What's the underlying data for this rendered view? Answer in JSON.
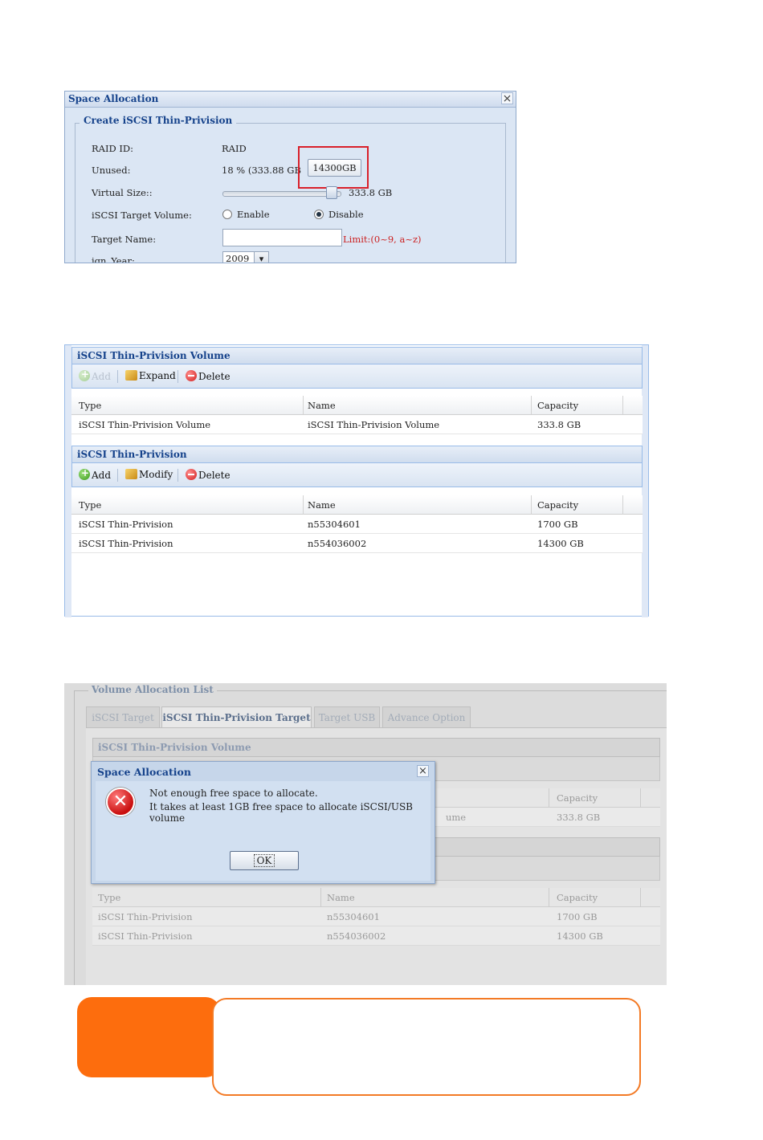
{
  "panel1": {
    "title": "Space Allocation",
    "close": "×",
    "legend": "Create iSCSI Thin-Privision",
    "labels": {
      "raid_id": "RAID ID:",
      "unused": "Unused:",
      "virtual_size": "Virtual Size::",
      "target_volume": "iSCSI Target Volume:",
      "target_name": "Target Name:",
      "iqn_year": "iqn_Year:"
    },
    "values": {
      "raid_id": "RAID",
      "unused": "18 % (333.88 GB",
      "size_button": "14300GB",
      "virtual_size": "333.8 GB",
      "slider_level": 0.96,
      "enable": "Enable",
      "disable": "Disable",
      "selected": "Disable",
      "target_name_value": "",
      "limit_hint": "Limit:(0~9, a~z)",
      "year": "2009",
      "year_arrow": "▾"
    },
    "highlight_color": "#d9202a"
  },
  "panel2": {
    "volume_section": {
      "title": "iSCSI Thin-Privision Volume",
      "toolbar": {
        "add": "Add",
        "expand": "Expand",
        "delete": "Delete"
      },
      "columns": [
        "Type",
        "Name",
        "Capacity"
      ],
      "rows": [
        {
          "type": "iSCSI Thin-Privision Volume",
          "name": "iSCSI Thin-Privision Volume",
          "capacity": "333.8 GB"
        }
      ]
    },
    "target_section": {
      "title": "iSCSI Thin-Privision",
      "toolbar": {
        "add": "Add",
        "modify": "Modify",
        "delete": "Delete"
      },
      "columns": [
        "Type",
        "Name",
        "Capacity"
      ],
      "rows": [
        {
          "type": "iSCSI Thin-Privision",
          "name": "n55304601",
          "capacity": "1700 GB"
        },
        {
          "type": "iSCSI Thin-Privision",
          "name": "n554036002",
          "capacity": "14300 GB"
        }
      ]
    }
  },
  "panel3": {
    "legend": "Volume Allocation List",
    "tabs": [
      "iSCSI Target",
      "iSCSI Thin-Privision Target",
      "Target USB",
      "Advance Option"
    ],
    "active_tab": "iSCSI Thin-Privision Target",
    "volume_section_title": "iSCSI Thin-Privision Volume",
    "columns": [
      "Type",
      "Name",
      "Capacity"
    ],
    "volume_row": {
      "name_tail": "ume",
      "capacity": "333.8 GB"
    },
    "rows": [
      {
        "type": "iSCSI Thin-Privision",
        "name": "n55304601",
        "capacity": "1700 GB"
      },
      {
        "type": "iSCSI Thin-Privision",
        "name": "n554036002",
        "capacity": "14300 GB"
      }
    ],
    "dialog": {
      "title": "Space Allocation",
      "close": "×",
      "icon": "error-icon",
      "icon_glyph": "✕",
      "message_line1": "Not enough free space to allocate.",
      "message_line2": "It takes at least 1GB free space to allocate iSCSI/USB volume",
      "ok": "OK"
    }
  },
  "colors": {
    "note_tab": "#fd6d0d",
    "note_border": "#f37a25",
    "header_blue": "#15428b"
  }
}
